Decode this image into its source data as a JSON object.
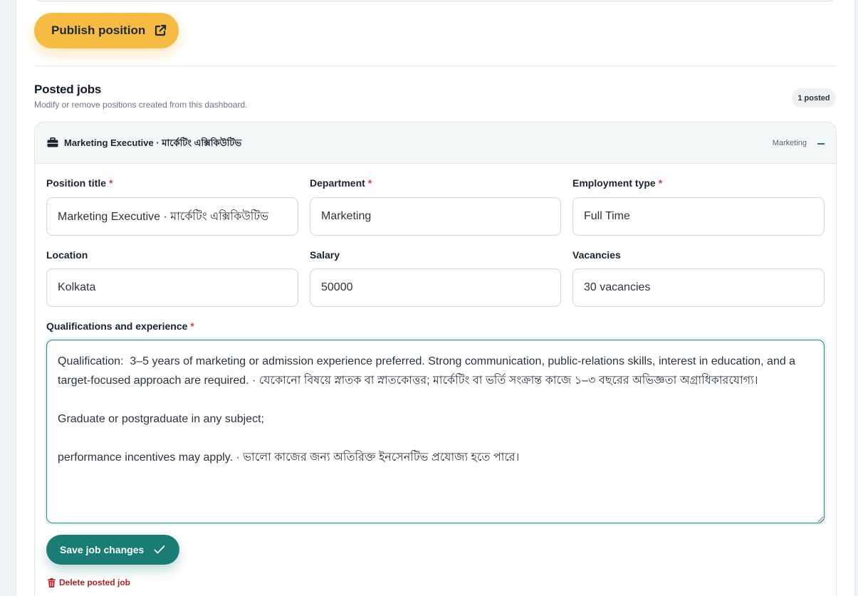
{
  "actions": {
    "publish_label": "Publish position"
  },
  "posted": {
    "title": "Posted jobs",
    "subtitle": "Modify or remove positions created from this dashboard.",
    "count_badge": "1 posted"
  },
  "job": {
    "header_title": "Marketing Executive · মার্কেটিং এক্সিকিউটিভ",
    "header_department": "Marketing",
    "fields": {
      "position_title": {
        "label": "Position title",
        "value": "Marketing Executive · মার্কেটিং এক্সিকিউটিভ",
        "required": "*"
      },
      "department": {
        "label": "Department",
        "value": "Marketing",
        "required": "*"
      },
      "employment_type": {
        "label": "Employment type",
        "value": "Full Time",
        "required": "*"
      },
      "location": {
        "label": "Location",
        "value": "Kolkata"
      },
      "salary": {
        "label": "Salary",
        "value": "50000"
      },
      "vacancies": {
        "label": "Vacancies",
        "value": "30 vacancies"
      },
      "qualifications": {
        "label": "Qualifications and experience",
        "required": "*",
        "value": "Qualification:  3–5 years of marketing or admission experience preferred. Strong communication, public-relations skills, interest in education, and a target-focused approach are required. · যেকোনো বিষয়ে স্নাতক বা স্নাতকোত্তর; মার্কেটিং বা ভর্তি সংক্রান্ত কাজে ১–৩ বছরের অভিজ্ঞতা অগ্রাধিকারযোগ্য।\n\nGraduate or postgraduate in any subject;\n\nperformance incentives may apply. · ভালো কাজের জন্য অতিরিক্ত ইনসেনটিভ প্রযোজ্য হতে পারে।"
      }
    },
    "save_label": "Save job changes",
    "delete_label": "Delete posted job"
  },
  "colors": {
    "accent_yellow": "#f6bb42",
    "accent_teal": "#1a7d74",
    "danger": "#b42323"
  },
  "icons": {
    "publish": "external-link-icon",
    "job": "briefcase-icon",
    "collapse": "minus-icon",
    "save": "check-icon",
    "delete": "trash-icon"
  }
}
